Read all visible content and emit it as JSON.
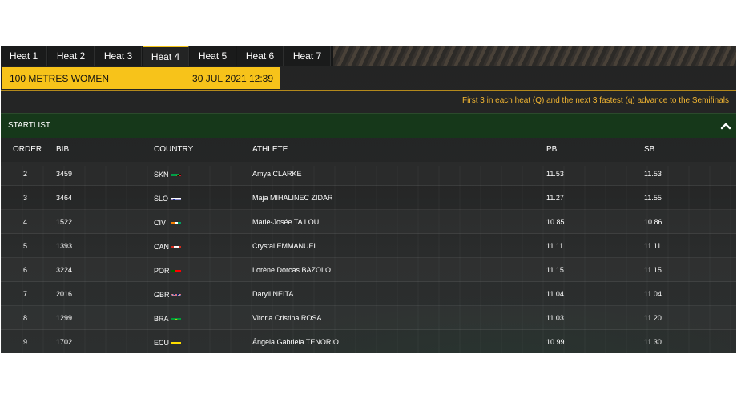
{
  "tabs": [
    {
      "label": "Heat 1",
      "active": false
    },
    {
      "label": "Heat 2",
      "active": false
    },
    {
      "label": "Heat 3",
      "active": false
    },
    {
      "label": "Heat 4",
      "active": true
    },
    {
      "label": "Heat 5",
      "active": false
    },
    {
      "label": "Heat 6",
      "active": false
    },
    {
      "label": "Heat 7",
      "active": false
    }
  ],
  "event": {
    "name": "100 METRES WOMEN",
    "datetime": "30 JUL 2021 12:39"
  },
  "advance_note": "First 3 in each heat (Q) and the next 3 fastest (q) advance to the Semifinals",
  "startlist": {
    "title": "STARTLIST",
    "collapse_icon": "chevron-up-icon",
    "columns": {
      "order": "ORDER",
      "bib": "BIB",
      "country": "COUNTRY",
      "athlete": "ATHLETE",
      "pb": "PB",
      "sb": "SB"
    },
    "rows": [
      {
        "order": "2",
        "bib": "3459",
        "country": "SKN",
        "athlete": "Amya CLARKE",
        "pb": "11.53",
        "sb": "11.53"
      },
      {
        "order": "3",
        "bib": "3464",
        "country": "SLO",
        "athlete": "Maja MIHALINEC ZIDAR",
        "pb": "11.27",
        "sb": "11.55"
      },
      {
        "order": "4",
        "bib": "1522",
        "country": "CIV",
        "athlete": "Marie-Josée TA LOU",
        "pb": "10.85",
        "sb": "10.86"
      },
      {
        "order": "5",
        "bib": "1393",
        "country": "CAN",
        "athlete": "Crystal EMMANUEL",
        "pb": "11.11",
        "sb": "11.11"
      },
      {
        "order": "6",
        "bib": "3224",
        "country": "POR",
        "athlete": "Lorène Dorcas BAZOLO",
        "pb": "11.15",
        "sb": "11.15"
      },
      {
        "order": "7",
        "bib": "2016",
        "country": "GBR",
        "athlete": "Daryll NEITA",
        "pb": "11.04",
        "sb": "11.04"
      },
      {
        "order": "8",
        "bib": "1299",
        "country": "BRA",
        "athlete": "Vitoria Cristina ROSA",
        "pb": "11.03",
        "sb": "11.20"
      },
      {
        "order": "9",
        "bib": "1702",
        "country": "ECU",
        "athlete": "Ángela Gabriela TENORIO",
        "pb": "10.99",
        "sb": "11.30"
      }
    ]
  },
  "colors": {
    "accent": "#f7c31a",
    "note": "#f2b632",
    "startlist_bar": "#16381a"
  }
}
